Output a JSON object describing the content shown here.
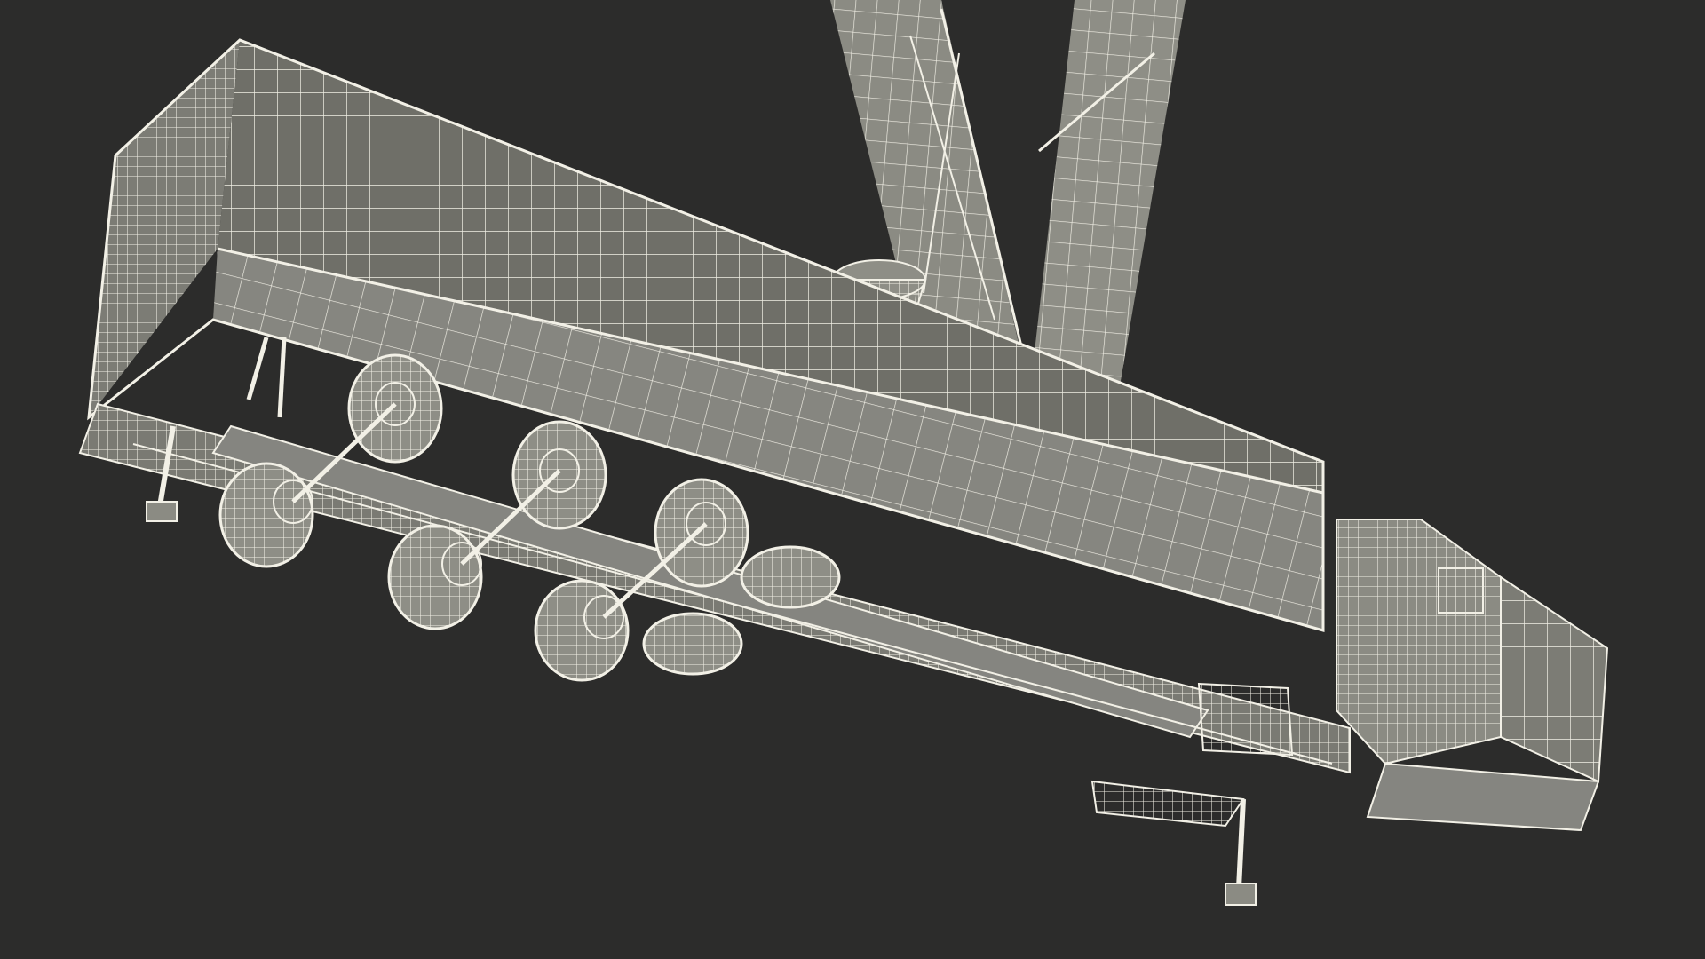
{
  "scene": {
    "background_color": "#2c2c2b",
    "surface_color": "#8e8e85",
    "surface_dark_color": "#6f6f68",
    "wire_color": "#f2f0e6",
    "subject": "wireframe-3d-model-trailer-with-mast"
  }
}
